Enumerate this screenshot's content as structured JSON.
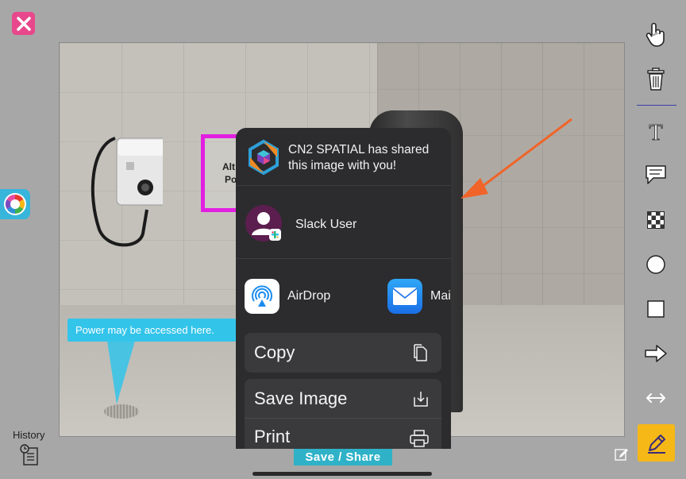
{
  "app": {
    "history_label": "History",
    "save_share_label": "Save / Share",
    "colors": {
      "accent_yellow": "#f6b817",
      "accent_cyan": "#2fb2c8",
      "close_pink": "#e8478b",
      "annotation_magenta": "#e21fe1",
      "arrow_orange": "#f0642a"
    }
  },
  "canvas": {
    "annotation_callout": "Power may be accessed here.",
    "partial_label_line1": "Alt",
    "partial_label_line2": "Po"
  },
  "toolbar": {
    "tools": [
      "hand-pointer-icon",
      "trash-icon",
      "text-icon",
      "speech-bubble-icon",
      "checkerboard-blur-icon",
      "circle-icon",
      "square-icon",
      "arrow-right-icon",
      "double-arrow-icon",
      "pencil-icon"
    ]
  },
  "share_sheet": {
    "header_text": "CN2 SPATIAL has shared this image with you!",
    "person": {
      "name": "Slack User"
    },
    "apps": [
      {
        "label": "AirDrop",
        "icon": "airdrop-icon"
      },
      {
        "label": "Mail",
        "icon": "mail-icon"
      }
    ],
    "actions": {
      "copy": "Copy",
      "save_image": "Save Image",
      "print": "Print"
    }
  }
}
